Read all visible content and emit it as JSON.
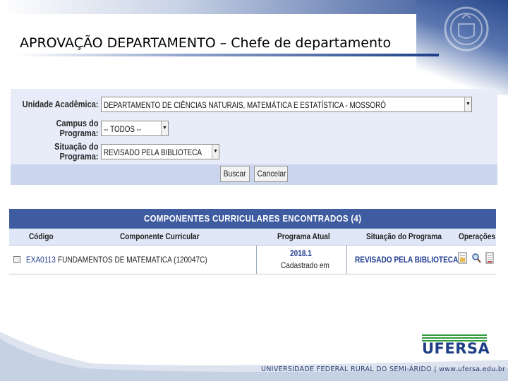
{
  "slide": {
    "title": "APROVAÇÃO DEPARTAMENTO – Chefe de departamento",
    "footer": "UNIVERSIDADE FEDERAL RURAL DO SEMI-ÁRIDO | www.ufersa.edu.br",
    "logo_text": "UFERSA"
  },
  "filter": {
    "fields": [
      {
        "label": "Unidade Acadêmica:",
        "value": "DEPARTAMENTO DE CIÊNCIAS NATURAIS, MATEMÁTICA E ESTATÍSTICA - MOSSORÓ"
      },
      {
        "label": "Campus do Programa:",
        "value": "-- TODOS --"
      },
      {
        "label": "Situação do Programa:",
        "value": "REVISADO PELA BIBLIOTECA"
      }
    ],
    "search_label": "Buscar",
    "cancel_label": "Cancelar"
  },
  "results": {
    "caption": "COMPONENTES CURRICULARES ENCONTRADOS (4)",
    "columns": [
      "Código",
      "Componente Curricular",
      "Programa Atual",
      "Situação do Programa",
      "Operações"
    ],
    "rows": [
      {
        "code": "EXA0113",
        "component": "FUNDAMENTOS DE MATEMATICA (120047C)",
        "program_year": "2018.1",
        "program_status": "Cadastrado em",
        "situation": "REVISADO PELA BIBLIOTECA"
      }
    ]
  },
  "icons": {
    "operations": [
      "edit-document-icon",
      "magnifier-icon",
      "report-icon"
    ]
  },
  "colors": {
    "caption_bg": "#3f5ca0",
    "link": "#1e3a90",
    "logo_blue": "#1f3f86",
    "logo_green": "#2e9a3c"
  }
}
